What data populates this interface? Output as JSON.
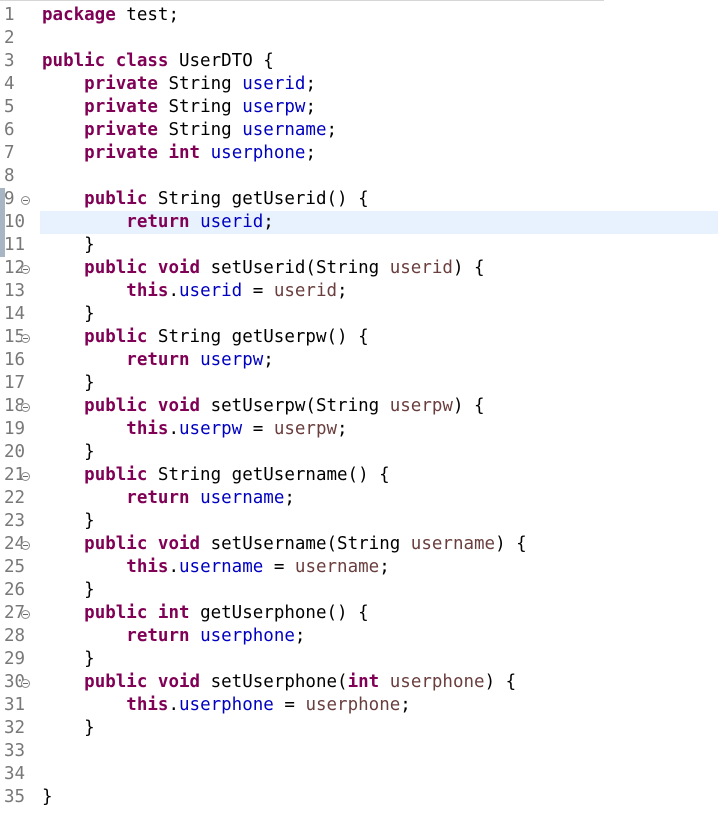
{
  "editor": {
    "language": "java",
    "colors": {
      "keyword": "#7f0055",
      "field": "#0000c0",
      "parameter": "#6a3e3e",
      "plain": "#000000",
      "line_number": "#787878",
      "current_line": "#e8f2fe"
    },
    "current_line": 10,
    "lines": [
      {
        "n": "1",
        "tokens": [
          {
            "t": "kw",
            "v": "package"
          },
          {
            "t": "pl",
            "v": " test;"
          }
        ]
      },
      {
        "n": "2",
        "tokens": []
      },
      {
        "n": "3",
        "tokens": [
          {
            "t": "kw",
            "v": "public"
          },
          {
            "t": "pl",
            "v": " "
          },
          {
            "t": "kw",
            "v": "class"
          },
          {
            "t": "pl",
            "v": " UserDTO {"
          }
        ]
      },
      {
        "n": "4",
        "tokens": [
          {
            "t": "pl",
            "v": "    "
          },
          {
            "t": "kw",
            "v": "private"
          },
          {
            "t": "pl",
            "v": " String "
          },
          {
            "t": "fld",
            "v": "userid"
          },
          {
            "t": "pl",
            "v": ";"
          }
        ]
      },
      {
        "n": "5",
        "tokens": [
          {
            "t": "pl",
            "v": "    "
          },
          {
            "t": "kw",
            "v": "private"
          },
          {
            "t": "pl",
            "v": " String "
          },
          {
            "t": "fld",
            "v": "userpw"
          },
          {
            "t": "pl",
            "v": ";"
          }
        ]
      },
      {
        "n": "6",
        "tokens": [
          {
            "t": "pl",
            "v": "    "
          },
          {
            "t": "kw",
            "v": "private"
          },
          {
            "t": "pl",
            "v": " String "
          },
          {
            "t": "fld",
            "v": "username"
          },
          {
            "t": "pl",
            "v": ";"
          }
        ]
      },
      {
        "n": "7",
        "tokens": [
          {
            "t": "pl",
            "v": "    "
          },
          {
            "t": "kw",
            "v": "private"
          },
          {
            "t": "pl",
            "v": " "
          },
          {
            "t": "kw",
            "v": "int"
          },
          {
            "t": "pl",
            "v": " "
          },
          {
            "t": "fld",
            "v": "userphone"
          },
          {
            "t": "pl",
            "v": ";"
          }
        ]
      },
      {
        "n": "8",
        "tokens": []
      },
      {
        "n": "9",
        "fold": true,
        "marker": true,
        "tokens": [
          {
            "t": "pl",
            "v": "    "
          },
          {
            "t": "kw",
            "v": "public"
          },
          {
            "t": "pl",
            "v": " String getUserid() {"
          }
        ]
      },
      {
        "n": "10",
        "marker": true,
        "tokens": [
          {
            "t": "pl",
            "v": "        "
          },
          {
            "t": "kw",
            "v": "return"
          },
          {
            "t": "pl",
            "v": " "
          },
          {
            "t": "fld",
            "v": "userid"
          },
          {
            "t": "pl",
            "v": ";"
          }
        ]
      },
      {
        "n": "11",
        "marker": true,
        "tokens": [
          {
            "t": "pl",
            "v": "    }"
          }
        ]
      },
      {
        "n": "12",
        "fold": true,
        "tokens": [
          {
            "t": "pl",
            "v": "    "
          },
          {
            "t": "kw",
            "v": "public"
          },
          {
            "t": "pl",
            "v": " "
          },
          {
            "t": "kw",
            "v": "void"
          },
          {
            "t": "pl",
            "v": " setUserid(String "
          },
          {
            "t": "par",
            "v": "userid"
          },
          {
            "t": "pl",
            "v": ") {"
          }
        ]
      },
      {
        "n": "13",
        "tokens": [
          {
            "t": "pl",
            "v": "        "
          },
          {
            "t": "kw",
            "v": "this"
          },
          {
            "t": "pl",
            "v": "."
          },
          {
            "t": "fld",
            "v": "userid"
          },
          {
            "t": "pl",
            "v": " = "
          },
          {
            "t": "par",
            "v": "userid"
          },
          {
            "t": "pl",
            "v": ";"
          }
        ]
      },
      {
        "n": "14",
        "tokens": [
          {
            "t": "pl",
            "v": "    }"
          }
        ]
      },
      {
        "n": "15",
        "fold": true,
        "tokens": [
          {
            "t": "pl",
            "v": "    "
          },
          {
            "t": "kw",
            "v": "public"
          },
          {
            "t": "pl",
            "v": " String getUserpw() {"
          }
        ]
      },
      {
        "n": "16",
        "tokens": [
          {
            "t": "pl",
            "v": "        "
          },
          {
            "t": "kw",
            "v": "return"
          },
          {
            "t": "pl",
            "v": " "
          },
          {
            "t": "fld",
            "v": "userpw"
          },
          {
            "t": "pl",
            "v": ";"
          }
        ]
      },
      {
        "n": "17",
        "tokens": [
          {
            "t": "pl",
            "v": "    }"
          }
        ]
      },
      {
        "n": "18",
        "fold": true,
        "tokens": [
          {
            "t": "pl",
            "v": "    "
          },
          {
            "t": "kw",
            "v": "public"
          },
          {
            "t": "pl",
            "v": " "
          },
          {
            "t": "kw",
            "v": "void"
          },
          {
            "t": "pl",
            "v": " setUserpw(String "
          },
          {
            "t": "par",
            "v": "userpw"
          },
          {
            "t": "pl",
            "v": ") {"
          }
        ]
      },
      {
        "n": "19",
        "tokens": [
          {
            "t": "pl",
            "v": "        "
          },
          {
            "t": "kw",
            "v": "this"
          },
          {
            "t": "pl",
            "v": "."
          },
          {
            "t": "fld",
            "v": "userpw"
          },
          {
            "t": "pl",
            "v": " = "
          },
          {
            "t": "par",
            "v": "userpw"
          },
          {
            "t": "pl",
            "v": ";"
          }
        ]
      },
      {
        "n": "20",
        "tokens": [
          {
            "t": "pl",
            "v": "    }"
          }
        ]
      },
      {
        "n": "21",
        "fold": true,
        "tokens": [
          {
            "t": "pl",
            "v": "    "
          },
          {
            "t": "kw",
            "v": "public"
          },
          {
            "t": "pl",
            "v": " String getUsername() {"
          }
        ]
      },
      {
        "n": "22",
        "tokens": [
          {
            "t": "pl",
            "v": "        "
          },
          {
            "t": "kw",
            "v": "return"
          },
          {
            "t": "pl",
            "v": " "
          },
          {
            "t": "fld",
            "v": "username"
          },
          {
            "t": "pl",
            "v": ";"
          }
        ]
      },
      {
        "n": "23",
        "tokens": [
          {
            "t": "pl",
            "v": "    }"
          }
        ]
      },
      {
        "n": "24",
        "fold": true,
        "tokens": [
          {
            "t": "pl",
            "v": "    "
          },
          {
            "t": "kw",
            "v": "public"
          },
          {
            "t": "pl",
            "v": " "
          },
          {
            "t": "kw",
            "v": "void"
          },
          {
            "t": "pl",
            "v": " setUsername(String "
          },
          {
            "t": "par",
            "v": "username"
          },
          {
            "t": "pl",
            "v": ") {"
          }
        ]
      },
      {
        "n": "25",
        "tokens": [
          {
            "t": "pl",
            "v": "        "
          },
          {
            "t": "kw",
            "v": "this"
          },
          {
            "t": "pl",
            "v": "."
          },
          {
            "t": "fld",
            "v": "username"
          },
          {
            "t": "pl",
            "v": " = "
          },
          {
            "t": "par",
            "v": "username"
          },
          {
            "t": "pl",
            "v": ";"
          }
        ]
      },
      {
        "n": "26",
        "tokens": [
          {
            "t": "pl",
            "v": "    }"
          }
        ]
      },
      {
        "n": "27",
        "fold": true,
        "tokens": [
          {
            "t": "pl",
            "v": "    "
          },
          {
            "t": "kw",
            "v": "public"
          },
          {
            "t": "pl",
            "v": " "
          },
          {
            "t": "kw",
            "v": "int"
          },
          {
            "t": "pl",
            "v": " getUserphone() {"
          }
        ]
      },
      {
        "n": "28",
        "tokens": [
          {
            "t": "pl",
            "v": "        "
          },
          {
            "t": "kw",
            "v": "return"
          },
          {
            "t": "pl",
            "v": " "
          },
          {
            "t": "fld",
            "v": "userphone"
          },
          {
            "t": "pl",
            "v": ";"
          }
        ]
      },
      {
        "n": "29",
        "tokens": [
          {
            "t": "pl",
            "v": "    }"
          }
        ]
      },
      {
        "n": "30",
        "fold": true,
        "tokens": [
          {
            "t": "pl",
            "v": "    "
          },
          {
            "t": "kw",
            "v": "public"
          },
          {
            "t": "pl",
            "v": " "
          },
          {
            "t": "kw",
            "v": "void"
          },
          {
            "t": "pl",
            "v": " setUserphone("
          },
          {
            "t": "kw",
            "v": "int"
          },
          {
            "t": "pl",
            "v": " "
          },
          {
            "t": "par",
            "v": "userphone"
          },
          {
            "t": "pl",
            "v": ") {"
          }
        ]
      },
      {
        "n": "31",
        "tokens": [
          {
            "t": "pl",
            "v": "        "
          },
          {
            "t": "kw",
            "v": "this"
          },
          {
            "t": "pl",
            "v": "."
          },
          {
            "t": "fld",
            "v": "userphone"
          },
          {
            "t": "pl",
            "v": " = "
          },
          {
            "t": "par",
            "v": "userphone"
          },
          {
            "t": "pl",
            "v": ";"
          }
        ]
      },
      {
        "n": "32",
        "tokens": [
          {
            "t": "pl",
            "v": "    }"
          }
        ]
      },
      {
        "n": "33",
        "tokens": []
      },
      {
        "n": "34",
        "tokens": []
      },
      {
        "n": "35",
        "tokens": [
          {
            "t": "pl",
            "v": "}"
          }
        ]
      }
    ]
  }
}
